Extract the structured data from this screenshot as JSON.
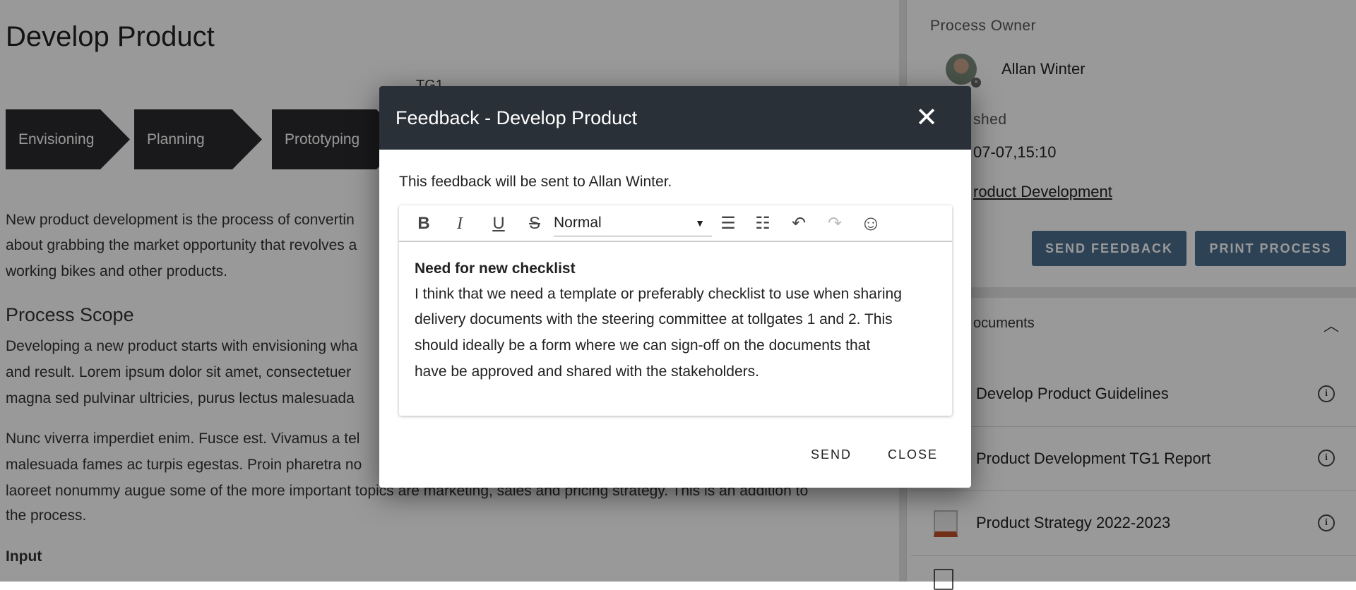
{
  "main": {
    "title": "Develop Product",
    "tollgate": "TG1",
    "phases": [
      "Envisioning",
      "Planning",
      "Prototyping"
    ],
    "intro": [
      "New product development is the process of convertin",
      "about grabbing the market opportunity that revolves a",
      "working bikes and other products."
    ],
    "scope_heading": "Process Scope",
    "scope": [
      "Developing a new product starts with envisioning wha",
      "and result. Lorem ipsum dolor sit amet, consectetuer",
      "magna sed pulvinar ultricies, purus lectus malesuada"
    ],
    "para3": [
      "Nunc viverra imperdiet enim. Fusce est. Vivamus a tel",
      "malesuada fames ac turpis egestas. Proin pharetra no",
      "laoreet nonummy augue some of the more important topics are marketing, sales and pricing strategy. This is an addition to",
      "the process."
    ],
    "input_heading": "Input"
  },
  "side": {
    "owner_label": "Process Owner",
    "owner_name": "Allan Winter",
    "published_label": "shed",
    "published_value": "07-07,15:10",
    "category_link": "roduct Development",
    "send_feedback": "SEND FEEDBACK",
    "print_process": "PRINT PROCESS",
    "documents_label": "ocuments",
    "documents": [
      "Develop Product Guidelines",
      "Product Development TG1 Report",
      "Product Strategy 2022-2023"
    ],
    "info_glyph": "i"
  },
  "modal": {
    "title": "Feedback - Develop Product",
    "close_glyph": "✕",
    "recipient_text": "This feedback will be sent to Allan Winter.",
    "toolbar": {
      "bold": "B",
      "italic": "I",
      "underline": "U",
      "strike": "S",
      "format": "Normal",
      "dropdown": "▼",
      "bullets": "☰",
      "numbered": "☷",
      "undo": "↶",
      "redo": "↷",
      "emoji": "☺"
    },
    "body_heading": "Need for new checklist",
    "body_lines": [
      "I think that we need a template or preferably checklist to use when sharing",
      "delivery documents with the steering committee at tollgates 1 and 2. This",
      "should ideally be a form where we can sign-off on the documents that",
      "have be approved and shared with the stakeholders."
    ],
    "send": "SEND",
    "close": "CLOSE"
  },
  "colors": {
    "header": "#2a3038",
    "button": "#4e6e8e",
    "phase": "#2b2b2e"
  }
}
